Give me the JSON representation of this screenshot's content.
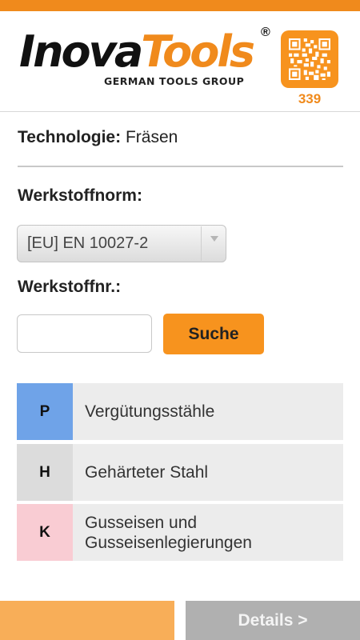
{
  "brand": {
    "logo_primary": "Inova",
    "logo_secondary": "Tools",
    "logo_registered": "®",
    "logo_tagline": "GERMAN TOOLS GROUP",
    "primary_color": "#f08a1c"
  },
  "qr": {
    "icon": "qr-code-icon",
    "count": "339"
  },
  "technology": {
    "label": "Technologie:",
    "value": "Fräsen"
  },
  "standard": {
    "label": "Werkstoffnorm:",
    "selected": "[EU] EN 10027-2"
  },
  "material_number": {
    "label": "Werkstoffnr.:",
    "value": "",
    "placeholder": ""
  },
  "search": {
    "label": "Suche"
  },
  "material_groups": [
    {
      "code": "P",
      "name": "Vergütungsstähle",
      "color": "#6fa3e8"
    },
    {
      "code": "H",
      "name": "Gehärteter Stahl",
      "color": "#dcdcdc"
    },
    {
      "code": "K",
      "name": "Gusseisen und Gusseisenlegierungen",
      "color": "#f9ccd3"
    }
  ],
  "footer": {
    "details_label": "Details >",
    "left_color": "#f8ae58",
    "right_color": "#b0b0b0"
  }
}
